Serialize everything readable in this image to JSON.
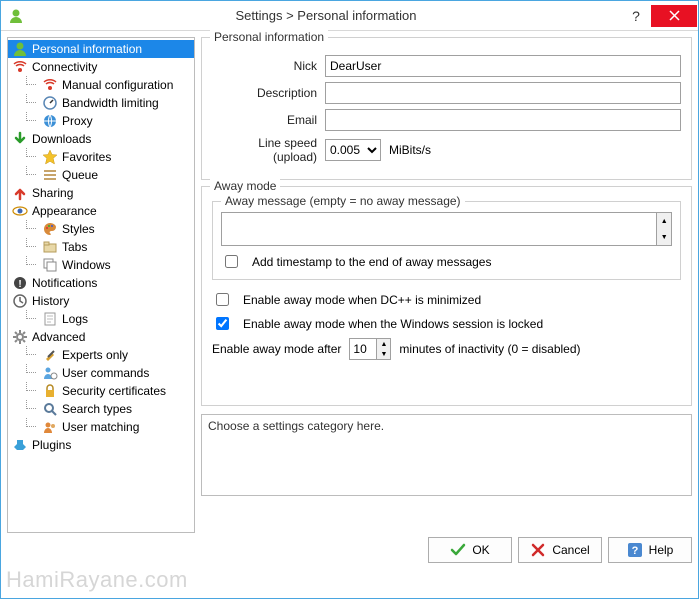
{
  "window": {
    "title": "Settings > Personal information"
  },
  "tree": [
    {
      "id": "personal",
      "label": "Personal information",
      "level": 0,
      "icon": "user-green",
      "selected": true
    },
    {
      "id": "connectivity",
      "label": "Connectivity",
      "level": 0,
      "icon": "antenna-red"
    },
    {
      "id": "manual",
      "label": "Manual configuration",
      "level": 1,
      "icon": "antenna-red"
    },
    {
      "id": "bandwidth",
      "label": "Bandwidth limiting",
      "level": 1,
      "icon": "gauge"
    },
    {
      "id": "proxy",
      "label": "Proxy",
      "level": 1,
      "icon": "globe"
    },
    {
      "id": "downloads",
      "label": "Downloads",
      "level": 0,
      "icon": "arrow-down-green"
    },
    {
      "id": "favorites",
      "label": "Favorites",
      "level": 1,
      "icon": "star-yellow"
    },
    {
      "id": "queue",
      "label": "Queue",
      "level": 1,
      "icon": "queue"
    },
    {
      "id": "sharing",
      "label": "Sharing",
      "level": 0,
      "icon": "arrow-up-red"
    },
    {
      "id": "appearance",
      "label": "Appearance",
      "level": 0,
      "icon": "eye"
    },
    {
      "id": "styles",
      "label": "Styles",
      "level": 1,
      "icon": "palette"
    },
    {
      "id": "tabs",
      "label": "Tabs",
      "level": 1,
      "icon": "tabs"
    },
    {
      "id": "windows",
      "label": "Windows",
      "level": 1,
      "icon": "windows"
    },
    {
      "id": "notifications",
      "label": "Notifications",
      "level": 0,
      "icon": "bell"
    },
    {
      "id": "history",
      "label": "History",
      "level": 0,
      "icon": "clock"
    },
    {
      "id": "logs",
      "label": "Logs",
      "level": 1,
      "icon": "note"
    },
    {
      "id": "advanced",
      "label": "Advanced",
      "level": 0,
      "icon": "gear"
    },
    {
      "id": "experts",
      "label": "Experts only",
      "level": 1,
      "icon": "tools"
    },
    {
      "id": "usercmds",
      "label": "User commands",
      "level": 1,
      "icon": "user-cmd"
    },
    {
      "id": "security",
      "label": "Security certificates",
      "level": 1,
      "icon": "lock"
    },
    {
      "id": "searchtypes",
      "label": "Search types",
      "level": 1,
      "icon": "search"
    },
    {
      "id": "usermatch",
      "label": "User matching",
      "level": 1,
      "icon": "users"
    },
    {
      "id": "plugins",
      "label": "Plugins",
      "level": 0,
      "icon": "plugin"
    }
  ],
  "personal": {
    "legend": "Personal information",
    "nick_label": "Nick",
    "nick_value": "DearUser",
    "desc_label": "Description",
    "desc_value": "",
    "email_label": "Email",
    "email_value": "",
    "speed_label": "Line speed (upload)",
    "speed_value": "0.005",
    "speed_unit": "MiBits/s"
  },
  "away": {
    "legend": "Away mode",
    "msg_label": "Away message (empty = no away message)",
    "msg_value": "",
    "add_ts_label": "Add timestamp to the end of away messages",
    "add_ts_checked": false,
    "min_label": "Enable away mode when DC++ is minimized",
    "min_checked": false,
    "lock_label": "Enable away mode when the Windows session is locked",
    "lock_checked": true,
    "after_label_pre": "Enable away mode after",
    "after_value": "10",
    "after_label_post": "minutes of inactivity (0 = disabled)"
  },
  "hint": "Choose a settings category here.",
  "buttons": {
    "ok": "OK",
    "cancel": "Cancel",
    "help": "Help"
  },
  "watermark": "HamiRayane.com"
}
